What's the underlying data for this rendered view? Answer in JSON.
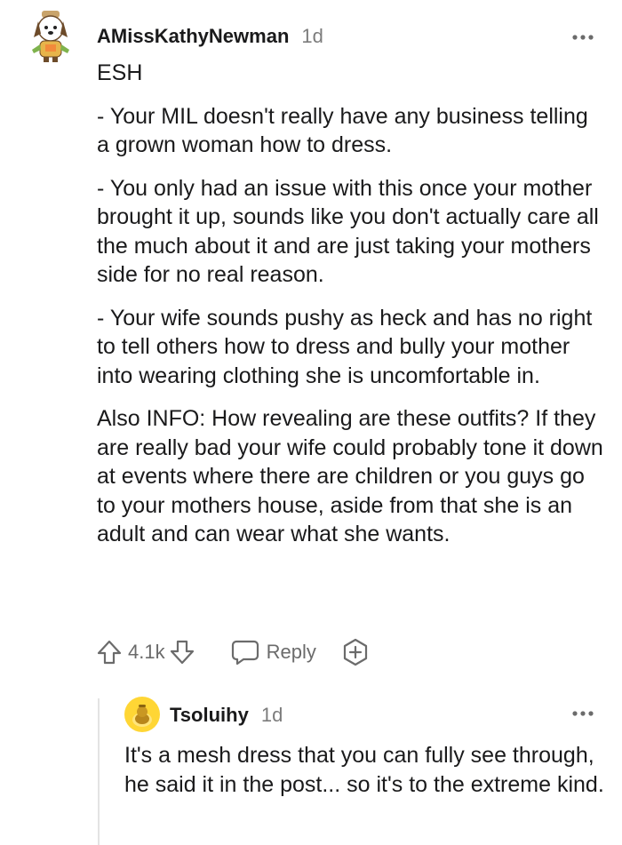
{
  "comment": {
    "author": "AMissKathyNewman",
    "time": "1d",
    "avatar_icon": "snoo-avatar-icon",
    "paragraphs": [
      "ESH",
      "- Your MIL doesn't really have any business telling a grown woman how to dress.",
      "- You only had an issue with this once your mother brought it up, sounds like you don't actually care all the much about it and are just taking your mothers side for no real reason.",
      "- Your wife sounds pushy as heck and has no right to tell others how to dress and bully your mother into wearing clothing she is uncomfortable in.",
      "Also INFO: How revealing are these outfits? If they are really bad your wife could probably tone it down at events where there are children or you guys go to your mothers house, aside from that she is an adult and can wear what she wants."
    ],
    "score": "4.1k",
    "reply_label": "Reply"
  },
  "reply": {
    "author": "Tsoluihy",
    "time": "1d",
    "avatar_icon": "snoo-avatar-icon",
    "text": "It's a mesh dress that you can fully see through, he said it in the post... so it's to the extreme kind."
  },
  "colors": {
    "text": "#1a1a1b",
    "meta": "#7c7c7c",
    "action": "#6b6b6b",
    "thread_line": "#e3e3e3",
    "reply_avatar_bg": "#ffd635"
  }
}
